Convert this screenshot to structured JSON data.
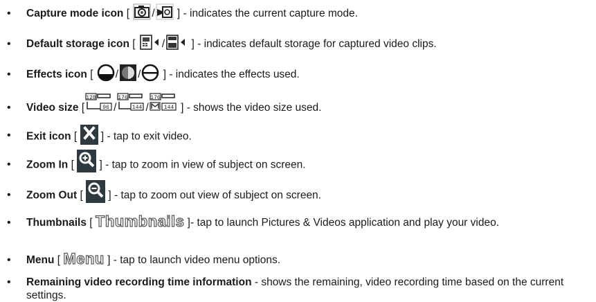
{
  "items": [
    {
      "label": "Capture mode icon",
      "pre": " [ ",
      "sep": "/",
      "post": " ] - indicates the current capture mode.",
      "icons": [
        "camera-icon",
        "video-camera-icon"
      ]
    },
    {
      "label": "Default storage icon",
      "pre": " [ ",
      "sep": "/",
      "post": " ] - indicates default storage for captured video clips.",
      "icons": [
        "phone-storage-icon",
        "card-storage-icon"
      ]
    },
    {
      "label": "Effects icon",
      "pre": " [ ",
      "sep": "/",
      "post": " ] - indicates the effects used.",
      "icons": [
        "effect-normal-icon",
        "effect-bw-icon",
        "effect-sepia-icon"
      ]
    },
    {
      "label": "Video size",
      "pre": " [",
      "sep": "/",
      "post": " ] - shows the video size used.",
      "icons": [
        "size-128x96-icon",
        "size-176x144-icon",
        "size-m176x144-icon"
      ],
      "size_labels": [
        [
          "128",
          "96"
        ],
        [
          "176",
          "144"
        ],
        [
          "176",
          "144"
        ]
      ]
    },
    {
      "label": "Exit icon",
      "pre": " [ ",
      "post": " ] - tap to exit video.",
      "icons": [
        "exit-icon"
      ]
    },
    {
      "label": "Zoom In",
      "pre": " [ ",
      "post": " ] - tap to zoom in view of subject on screen.",
      "icons": [
        "zoom-in-icon"
      ]
    },
    {
      "label": "Zoom Out",
      "pre": " [ ",
      "post": " ] - tap to zoom out view of subject on screen.",
      "icons": [
        "zoom-out-icon"
      ]
    },
    {
      "label": "Thumbnails",
      "pre": " [ ",
      "word": "Thumbnails",
      "post": " ]- tap to launch Pictures & Videos application and play your video."
    },
    {
      "label": "Menu",
      "pre": " [ ",
      "word": "Menu",
      "post": " ] - tap to launch video menu options."
    },
    {
      "label": "Remaining video recording time information",
      "post": " - shows the remaining, video recording time based on the current settings."
    }
  ],
  "bullet": "•",
  "colors": {
    "text": "#1a1a1a",
    "icon_dark": "#2e3a40",
    "icon_outline": "#555555"
  }
}
